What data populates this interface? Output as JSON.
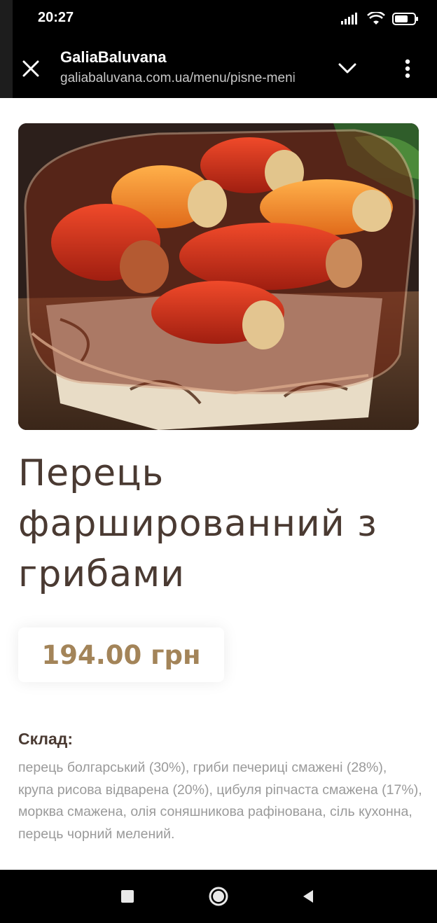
{
  "status_bar": {
    "time": "20:27",
    "icons": [
      "signal-icon",
      "wifi-icon",
      "battery-icon"
    ]
  },
  "browser": {
    "site_title": "GaliaBaluvana",
    "url": "galiabaluvana.com.ua/menu/pisne-meni",
    "icons": [
      "close-icon",
      "chevron-down-icon",
      "more-vertical-icon"
    ]
  },
  "product": {
    "image_alt": "stuffed peppers in glass dish",
    "title": "Перець фаршированний з грибами",
    "price": "194.00 грн",
    "composition_label": "Склад:",
    "composition_text": "перець болгарський (30%), гриби печериці смажені (28%), крупа рисова відварена (20%), цибуля ріпчаста смажена (17%), морква смажена, олія соняшникова рафінована, сіль кухонна, перець чорний мелений."
  },
  "nav_bar": {
    "icons": [
      "recents-square-icon",
      "home-circle-icon",
      "back-triangle-icon"
    ]
  },
  "colors": {
    "title": "#4a3a32",
    "price": "#a38459",
    "composition_text": "#9a9a9a"
  }
}
